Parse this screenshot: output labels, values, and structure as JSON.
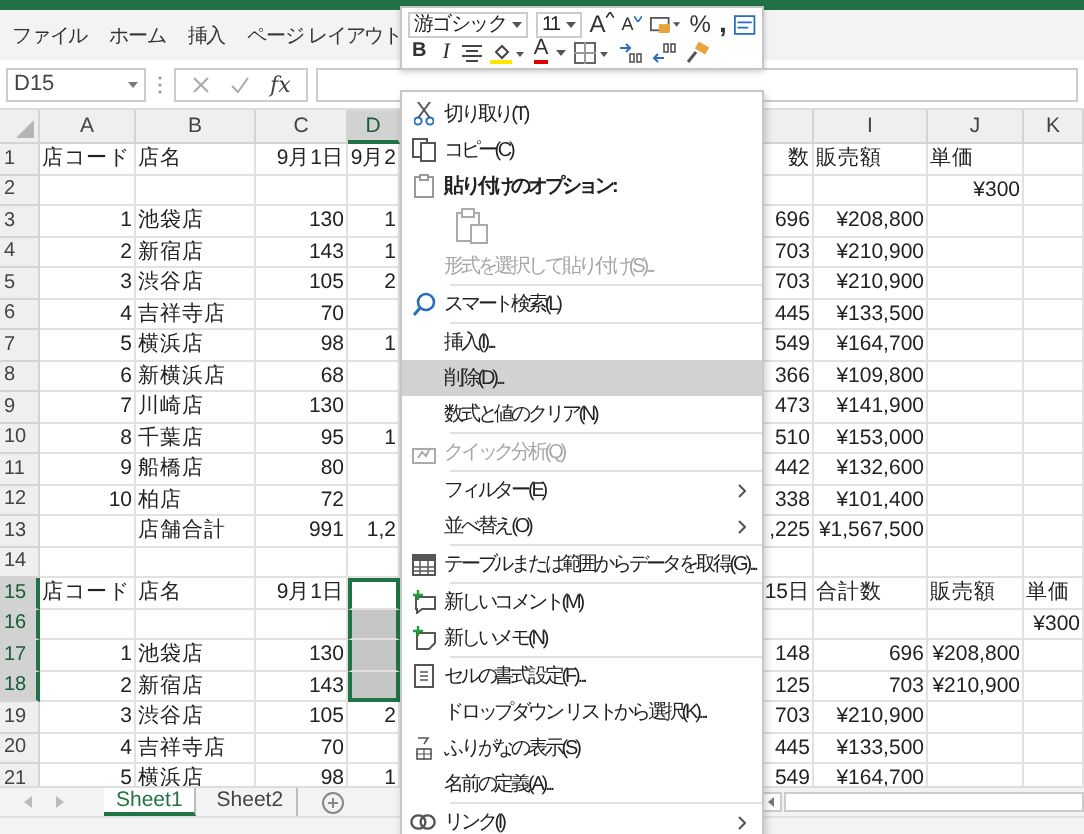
{
  "ribbon_tabs": [
    "ファイル",
    "ホーム",
    "挿入",
    "ページ レイアウト"
  ],
  "formula_bar": {
    "name_box": "D15",
    "function_label": "fx"
  },
  "sheet": {
    "column_headers": [
      {
        "label": "A",
        "selected": false
      },
      {
        "label": "B",
        "selected": false
      },
      {
        "label": "C",
        "selected": false
      },
      {
        "label": "D",
        "selected": true
      },
      {
        "label": "I",
        "selected": false
      },
      {
        "label": "J",
        "selected": false
      },
      {
        "label": "K",
        "selected": false
      }
    ],
    "rows": [
      {
        "number": "1",
        "selected": false,
        "cells": [
          {
            "text": "店コード",
            "kind": "text"
          },
          {
            "text": "店名",
            "kind": "text"
          },
          {
            "text": "9月1日",
            "kind": "number"
          },
          {
            "text": "9月2",
            "kind": "fragment"
          },
          {
            "text": "数",
            "kind": "fragment"
          },
          {
            "text": "販売額",
            "kind": "text"
          },
          {
            "text": "単価",
            "kind": "text"
          },
          null
        ]
      },
      {
        "number": "2",
        "selected": false,
        "cells": [
          null,
          null,
          null,
          null,
          null,
          null,
          {
            "text": "¥300",
            "kind": "number"
          },
          null
        ]
      },
      {
        "number": "3",
        "selected": false,
        "cells": [
          {
            "text": "1",
            "kind": "number"
          },
          {
            "text": "池袋店",
            "kind": "text"
          },
          {
            "text": "130",
            "kind": "number"
          },
          {
            "text": "1",
            "kind": "fragment"
          },
          {
            "text": "696",
            "kind": "number"
          },
          {
            "text": "¥208,800",
            "kind": "number"
          },
          null,
          null
        ]
      },
      {
        "number": "4",
        "selected": false,
        "cells": [
          {
            "text": "2",
            "kind": "number"
          },
          {
            "text": "新宿店",
            "kind": "text"
          },
          {
            "text": "143",
            "kind": "number"
          },
          {
            "text": "1",
            "kind": "fragment"
          },
          {
            "text": "703",
            "kind": "number"
          },
          {
            "text": "¥210,900",
            "kind": "number"
          },
          null,
          null
        ]
      },
      {
        "number": "5",
        "selected": false,
        "cells": [
          {
            "text": "3",
            "kind": "number"
          },
          {
            "text": "渋谷店",
            "kind": "text"
          },
          {
            "text": "105",
            "kind": "number"
          },
          {
            "text": "2",
            "kind": "fragment"
          },
          {
            "text": "703",
            "kind": "number"
          },
          {
            "text": "¥210,900",
            "kind": "number"
          },
          null,
          null
        ]
      },
      {
        "number": "6",
        "selected": false,
        "cells": [
          {
            "text": "4",
            "kind": "number"
          },
          {
            "text": "吉祥寺店",
            "kind": "text"
          },
          {
            "text": "70",
            "kind": "number"
          },
          null,
          {
            "text": "445",
            "kind": "number"
          },
          {
            "text": "¥133,500",
            "kind": "number"
          },
          null,
          null
        ]
      },
      {
        "number": "7",
        "selected": false,
        "cells": [
          {
            "text": "5",
            "kind": "number"
          },
          {
            "text": "横浜店",
            "kind": "text"
          },
          {
            "text": "98",
            "kind": "number"
          },
          {
            "text": "1",
            "kind": "fragment"
          },
          {
            "text": "549",
            "kind": "number"
          },
          {
            "text": "¥164,700",
            "kind": "number"
          },
          null,
          null
        ]
      },
      {
        "number": "8",
        "selected": false,
        "cells": [
          {
            "text": "6",
            "kind": "number"
          },
          {
            "text": "新横浜店",
            "kind": "text"
          },
          {
            "text": "68",
            "kind": "number"
          },
          null,
          {
            "text": "366",
            "kind": "number"
          },
          {
            "text": "¥109,800",
            "kind": "number"
          },
          null,
          null
        ]
      },
      {
        "number": "9",
        "selected": false,
        "cells": [
          {
            "text": "7",
            "kind": "number"
          },
          {
            "text": "川崎店",
            "kind": "text"
          },
          {
            "text": "130",
            "kind": "number"
          },
          null,
          {
            "text": "473",
            "kind": "number"
          },
          {
            "text": "¥141,900",
            "kind": "number"
          },
          null,
          null
        ]
      },
      {
        "number": "10",
        "selected": false,
        "cells": [
          {
            "text": "8",
            "kind": "number"
          },
          {
            "text": "千葉店",
            "kind": "text"
          },
          {
            "text": "95",
            "kind": "number"
          },
          {
            "text": "1",
            "kind": "fragment"
          },
          {
            "text": "510",
            "kind": "number"
          },
          {
            "text": "¥153,000",
            "kind": "number"
          },
          null,
          null
        ]
      },
      {
        "number": "11",
        "selected": false,
        "cells": [
          {
            "text": "9",
            "kind": "number"
          },
          {
            "text": "船橋店",
            "kind": "text"
          },
          {
            "text": "80",
            "kind": "number"
          },
          null,
          {
            "text": "442",
            "kind": "number"
          },
          {
            "text": "¥132,600",
            "kind": "number"
          },
          null,
          null
        ]
      },
      {
        "number": "12",
        "selected": false,
        "cells": [
          {
            "text": "10",
            "kind": "number"
          },
          {
            "text": "柏店",
            "kind": "text"
          },
          {
            "text": "72",
            "kind": "number"
          },
          null,
          {
            "text": "338",
            "kind": "number"
          },
          {
            "text": "¥101,400",
            "kind": "number"
          },
          null,
          null
        ]
      },
      {
        "number": "13",
        "selected": false,
        "cells": [
          null,
          {
            "text": "店舗合計",
            "kind": "text"
          },
          {
            "text": "991",
            "kind": "number"
          },
          {
            "text": "1,2",
            "kind": "fragment"
          },
          {
            "text": ",225",
            "kind": "fragment"
          },
          {
            "text": "¥1,567,500",
            "kind": "number"
          },
          null,
          null
        ]
      },
      {
        "number": "14",
        "selected": false,
        "cells": [
          null,
          null,
          null,
          null,
          null,
          null,
          null,
          null
        ]
      },
      {
        "number": "15",
        "selected": true,
        "cells": [
          {
            "text": "店コード",
            "kind": "text"
          },
          {
            "text": "店名",
            "kind": "text"
          },
          {
            "text": "9月1日",
            "kind": "number"
          },
          null,
          {
            "text": "15日",
            "kind": "fragment"
          },
          {
            "text": "合計数",
            "kind": "text"
          },
          {
            "text": "販売額",
            "kind": "text"
          },
          {
            "text": "単価",
            "kind": "text"
          }
        ]
      },
      {
        "number": "16",
        "selected": true,
        "cells": [
          null,
          null,
          null,
          null,
          null,
          null,
          null,
          {
            "text": "¥300",
            "kind": "number"
          }
        ]
      },
      {
        "number": "17",
        "selected": true,
        "cells": [
          {
            "text": "1",
            "kind": "number"
          },
          {
            "text": "池袋店",
            "kind": "text"
          },
          {
            "text": "130",
            "kind": "number"
          },
          null,
          {
            "text": "148",
            "kind": "number"
          },
          {
            "text": "696",
            "kind": "number"
          },
          {
            "text": "¥208,800",
            "kind": "number"
          },
          null
        ]
      },
      {
        "number": "18",
        "selected": true,
        "cells": [
          {
            "text": "2",
            "kind": "number"
          },
          {
            "text": "新宿店",
            "kind": "text"
          },
          {
            "text": "143",
            "kind": "number"
          },
          null,
          {
            "text": "125",
            "kind": "number"
          },
          {
            "text": "703",
            "kind": "number"
          },
          {
            "text": "¥210,900",
            "kind": "number"
          },
          null
        ]
      },
      {
        "number": "19",
        "selected": false,
        "cells": [
          {
            "text": "3",
            "kind": "number"
          },
          {
            "text": "渋谷店",
            "kind": "text"
          },
          {
            "text": "105",
            "kind": "number"
          },
          {
            "text": "2",
            "kind": "fragment"
          },
          {
            "text": "703",
            "kind": "number"
          },
          {
            "text": "¥210,900",
            "kind": "number"
          },
          null,
          null
        ]
      },
      {
        "number": "20",
        "selected": false,
        "cells": [
          {
            "text": "4",
            "kind": "number"
          },
          {
            "text": "吉祥寺店",
            "kind": "text"
          },
          {
            "text": "70",
            "kind": "number"
          },
          null,
          {
            "text": "445",
            "kind": "number"
          },
          {
            "text": "¥133,500",
            "kind": "number"
          },
          null,
          null
        ]
      },
      {
        "number": "21",
        "selected": false,
        "cells": [
          {
            "text": "5",
            "kind": "number"
          },
          {
            "text": "横浜店",
            "kind": "text"
          },
          {
            "text": "98",
            "kind": "number"
          },
          {
            "text": "1",
            "kind": "fragment"
          },
          {
            "text": "549",
            "kind": "number"
          },
          {
            "text": "¥164,700",
            "kind": "number"
          },
          null,
          null
        ]
      }
    ]
  },
  "sheet_tabs": [
    {
      "label": "Sheet1",
      "selected": true
    },
    {
      "label": "Sheet2",
      "selected": false
    }
  ],
  "mini_toolbar": {
    "font": "游ゴシック",
    "size": "11",
    "grow_font": "A",
    "shrink_font": "A",
    "percent": "%",
    "comma": ",",
    "bold": "B",
    "italic": "I",
    "font_color": "A"
  },
  "context_menu": {
    "groups": [
      [
        {
          "label": "切り取り(T)",
          "kind": "command",
          "disabled": false,
          "selected": false,
          "submenu": false
        },
        {
          "label": "コピー(C)",
          "kind": "command",
          "disabled": false,
          "selected": false,
          "submenu": false
        },
        {
          "label": "貼り付けのオプション:",
          "kind": "heading"
        },
        {
          "kind": "paste-options",
          "disabled": true
        },
        {
          "label": "形式を選択して貼り付け(S)...",
          "kind": "command",
          "disabled": true,
          "selected": false,
          "submenu": false
        }
      ],
      [
        {
          "label": "スマート検索(L)",
          "kind": "command",
          "disabled": false,
          "selected": false,
          "submenu": false
        }
      ],
      [
        {
          "label": "挿入(I)...",
          "kind": "command",
          "disabled": false,
          "selected": false,
          "submenu": false
        },
        {
          "label": "削除(D)...",
          "kind": "command",
          "disabled": false,
          "selected": true,
          "submenu": false
        },
        {
          "label": "数式と値のクリア(N)",
          "kind": "command",
          "disabled": false,
          "selected": false,
          "submenu": false
        }
      ],
      [
        {
          "label": "クイック分析(Q)",
          "kind": "command",
          "disabled": true,
          "selected": false,
          "submenu": false
        }
      ],
      [
        {
          "label": "フィルター(E)",
          "kind": "command",
          "disabled": false,
          "selected": false,
          "submenu": true
        },
        {
          "label": "並べ替え(O)",
          "kind": "command",
          "disabled": false,
          "selected": false,
          "submenu": true
        }
      ],
      [
        {
          "label": "テーブルまたは範囲からデータを取得(G)...",
          "kind": "command",
          "disabled": false,
          "selected": false,
          "submenu": false
        }
      ],
      [
        {
          "label": "新しいコメント(M)",
          "kind": "command",
          "disabled": false,
          "selected": false,
          "submenu": false
        },
        {
          "label": "新しいメモ(N)",
          "kind": "command",
          "disabled": false,
          "selected": false,
          "submenu": false
        }
      ],
      [
        {
          "label": "セルの書式設定(F)...",
          "kind": "command",
          "disabled": false,
          "selected": false,
          "submenu": false
        },
        {
          "label": "ドロップダウン リストから選択(K)...",
          "kind": "command",
          "disabled": false,
          "selected": false,
          "submenu": false
        },
        {
          "label": "ふりがなの表示(S)",
          "kind": "command",
          "disabled": false,
          "selected": false,
          "submenu": false
        },
        {
          "label": "名前の定義(A)...",
          "kind": "command",
          "disabled": false,
          "selected": false,
          "submenu": false
        }
      ],
      [
        {
          "label": "リンク(I)",
          "kind": "command",
          "disabled": false,
          "selected": false,
          "submenu": true
        }
      ]
    ]
  }
}
